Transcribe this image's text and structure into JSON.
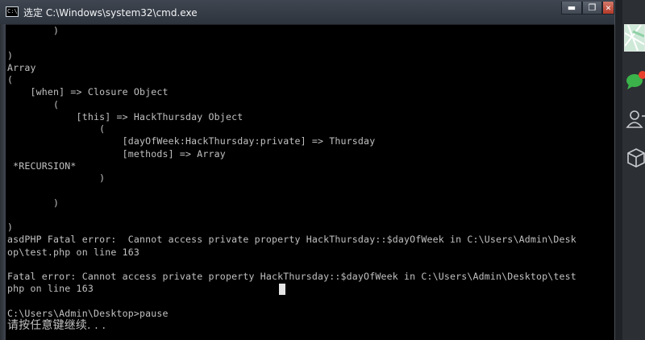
{
  "window": {
    "title": "选定 C:\\Windows\\system32\\cmd.exe",
    "controls": {
      "minimize": "▬",
      "maximize": "❐",
      "close": "✕"
    }
  },
  "console": {
    "lines": [
      "        )",
      "",
      ")",
      "Array",
      "(",
      "    [when] => Closure Object",
      "        (",
      "            [this] => HackThursday Object",
      "                (",
      "                    [dayOfWeek:HackThursday:private] => Thursday",
      "                    [methods] => Array",
      " *RECURSION*",
      "                )",
      "",
      "        )",
      "",
      ")",
      "asdPHP Fatal error:  Cannot access private property HackThursday::$dayOfWeek in C:\\Users\\Admin\\Desk",
      "op\\test.php on line 163",
      "",
      "Fatal error: Cannot access private property HackThursday::$dayOfWeek in C:\\Users\\Admin\\Desktop\\test",
      "php on line 163",
      "",
      "C:\\Users\\Admin\\Desktop>pause",
      "请按任意键继续. . ."
    ]
  },
  "dock": {
    "icons": [
      "map-icon",
      "chat-icon",
      "contacts-icon",
      "package-icon"
    ]
  },
  "colors": {
    "console_bg": "#000000",
    "console_text": "#c0c0c0",
    "titlebar": "#3a414b",
    "close_button": "#c2503c"
  }
}
